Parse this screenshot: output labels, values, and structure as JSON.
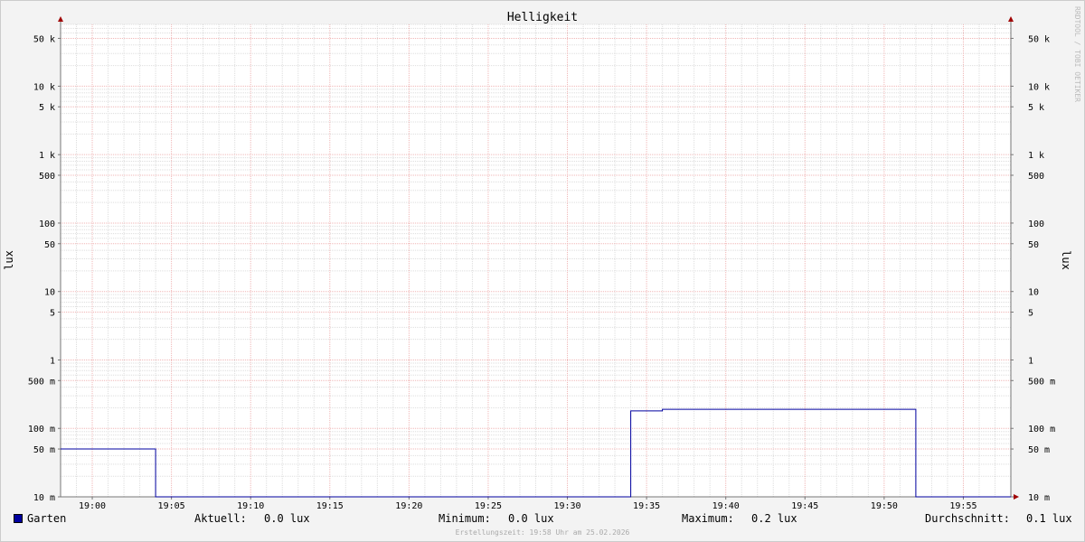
{
  "chart_data": {
    "type": "line",
    "title": "Helligkeit",
    "ylabel": "lux",
    "yscale": "log",
    "ylim": [
      0.01,
      80000
    ],
    "y_ticks": [
      {
        "value": 50000,
        "label": "50 k"
      },
      {
        "value": 10000,
        "label": "10 k"
      },
      {
        "value": 5000,
        "label": "5 k"
      },
      {
        "value": 1000,
        "label": "1 k"
      },
      {
        "value": 500,
        "label": "500"
      },
      {
        "value": 100,
        "label": "100"
      },
      {
        "value": 50,
        "label": "50"
      },
      {
        "value": 10,
        "label": "10"
      },
      {
        "value": 5,
        "label": "5"
      },
      {
        "value": 1,
        "label": "1"
      },
      {
        "value": 0.5,
        "label": "500 m"
      },
      {
        "value": 0.1,
        "label": "100 m"
      },
      {
        "value": 0.05,
        "label": "50 m"
      },
      {
        "value": 0.01,
        "label": "10 m"
      }
    ],
    "x_tick_labels": [
      "19:00",
      "19:05",
      "19:10",
      "19:15",
      "19:20",
      "19:25",
      "19:30",
      "19:35",
      "19:40",
      "19:45",
      "19:50",
      "19:55"
    ],
    "series": [
      {
        "name": "Garten",
        "color": "#0000a0",
        "points": [
          [
            "18:58",
            0.05
          ],
          [
            "19:04",
            0.05
          ],
          [
            "19:04",
            0.01
          ],
          [
            "19:34",
            0.01
          ],
          [
            "19:34",
            0.18
          ],
          [
            "19:36",
            0.18
          ],
          [
            "19:36",
            0.19
          ],
          [
            "19:52",
            0.19
          ],
          [
            "19:52",
            0.01
          ],
          [
            "19:58",
            0.01
          ]
        ]
      }
    ],
    "grid": true,
    "legend_position": "bottom"
  },
  "legend": {
    "series_name": "Garten",
    "current_label": "Aktuell:",
    "current_value": "0.0 lux",
    "min_label": "Minimum:",
    "min_value": "0.0 lux",
    "max_label": "Maximum:",
    "max_value": "0.2 lux",
    "avg_label": "Durchschnitt:",
    "avg_value": "0.1 lux"
  },
  "watermark": "RRDTOOL / TOBI OETIKER",
  "footer": "Erstellungszeit: 19:58 Uhr am 25.02.2026"
}
